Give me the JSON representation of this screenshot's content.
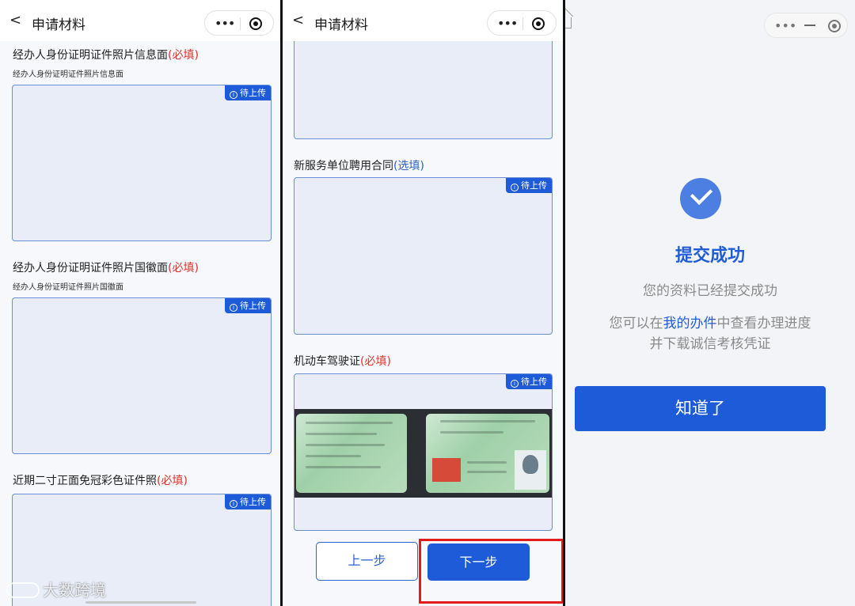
{
  "screen1": {
    "nav": {
      "back": "<",
      "title": "申请材料"
    },
    "fields": [
      {
        "title": "经办人身份证明证件照片信息面",
        "tag": "(必填)",
        "subtitle": "经办人身份证明证件照片信息面",
        "badge": "待上传"
      },
      {
        "title": "经办人身份证明证件照片国徽面",
        "tag": "(必填)",
        "subtitle": "经办人身份证明证件照片国徽面",
        "badge": "待上传"
      },
      {
        "title": "近期二寸正面免冠彩色证件照",
        "tag": "(必填)",
        "badge": "待上传"
      }
    ]
  },
  "screen2": {
    "nav": {
      "back": "<",
      "title": "申请材料"
    },
    "fields": [
      {
        "title": "新服务单位聘用合同",
        "tag": "(选填)",
        "badge": "待上传"
      },
      {
        "title": "机动车驾驶证",
        "tag": "(必填)",
        "badge": "待上传"
      }
    ],
    "buttons": {
      "prev": "上一步",
      "next": "下一步"
    }
  },
  "screen3": {
    "title": "提交成功",
    "message1": "您的资料已经提交成功",
    "message2_pre": "您可以在",
    "message2_link": "我的办件",
    "message2_post": "中查看办理进度",
    "message3": "并下载诚信考核凭证",
    "button": "知道了"
  },
  "watermark": "大数跨境",
  "colors": {
    "accent": "#1e5bd8",
    "required": "#e0302a",
    "optional": "#2b63c8",
    "highlight": "#e21c1c"
  }
}
